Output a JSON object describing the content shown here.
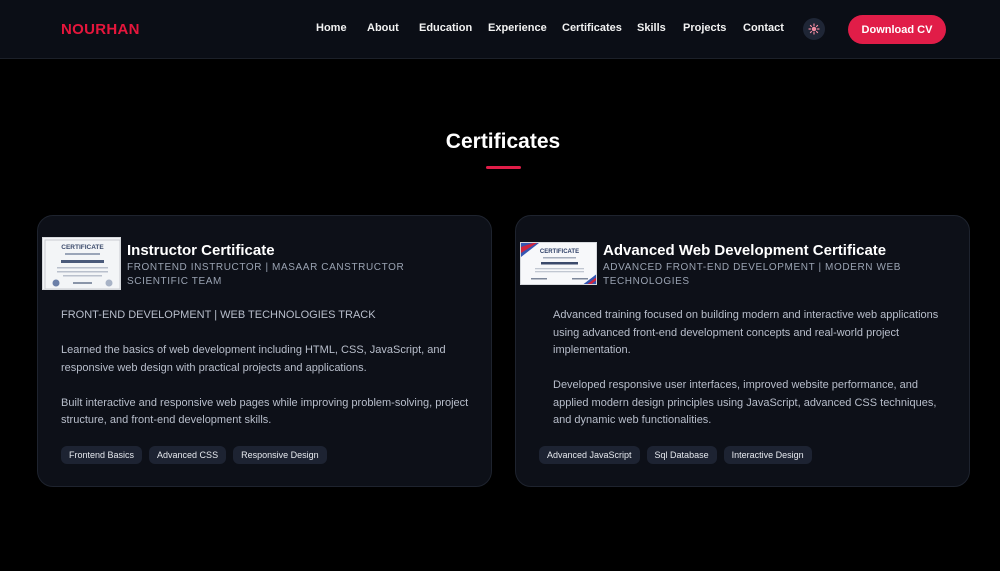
{
  "nav": {
    "logo": "NOURHAN",
    "links": [
      "Home",
      "About",
      "Education",
      "Experience",
      "Certificates",
      "Skills",
      "Projects",
      "Contact"
    ],
    "theme_icon": "gear-icon",
    "cv_button": "Download CV"
  },
  "section": {
    "title": "Certificates"
  },
  "cards": [
    {
      "title": "Instructor Certificate",
      "subtitle": "FRONTEND INSTRUCTOR | MASAAR CANSTRUCTOR SCIENTIFIC TEAM",
      "paragraphs": [
        "FRONT-END DEVELOPMENT | WEB TECHNOLOGIES TRACK",
        "Learned the basics of web development including HTML, CSS, JavaScript, and responsive web design with practical projects and applications.",
        "Built interactive and responsive web pages while improving problem-solving, project structure, and front-end development skills."
      ],
      "tags": [
        "Frontend Basics",
        "Advanced CSS",
        "Responsive Design"
      ],
      "thumb_label": "CERTIFICATE"
    },
    {
      "title": "Advanced Web Development Certificate",
      "subtitle": "ADVANCED FRONT-END DEVELOPMENT | MODERN WEB TECHNOLOGIES",
      "paragraphs": [
        "Advanced training focused on building modern and interactive web applications using advanced front-end development concepts and real-world project implementation.",
        "Developed responsive user interfaces, improved website performance, and applied modern design principles using JavaScript, advanced CSS techniques, and dynamic web functionalities."
      ],
      "tags": [
        "Advanced JavaScript",
        "Sql Database",
        "Interactive Design"
      ],
      "thumb_label": "CERTIFICATE"
    }
  ],
  "colors": {
    "accent": "#e11d48",
    "background": "#000000",
    "card": "#0d1018"
  }
}
